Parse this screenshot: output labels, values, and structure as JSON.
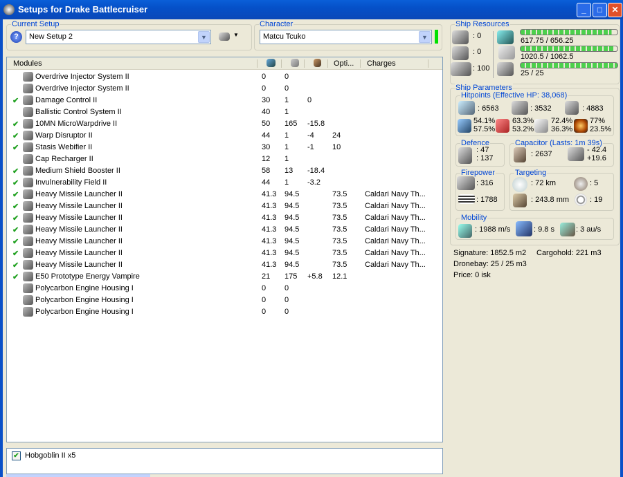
{
  "window": {
    "title": "Setups for Drake Battlecruiser",
    "buttons": {
      "minimize": "_",
      "maximize": "□",
      "close": "✕"
    }
  },
  "setup": {
    "label": "Current Setup",
    "value": "New Setup 2"
  },
  "character": {
    "label": "Character",
    "value": "Matcu Tcuko",
    "status_color": "#00e000"
  },
  "modules": {
    "headers": {
      "name": "Modules",
      "col4": "Opti...",
      "charges": "Charges"
    },
    "rows": [
      {
        "checked": false,
        "name": "Overdrive Injector System II",
        "c1": "0",
        "c2": "0",
        "c3": "",
        "opti": "",
        "charges": ""
      },
      {
        "checked": false,
        "name": "Overdrive Injector System II",
        "c1": "0",
        "c2": "0",
        "c3": "",
        "opti": "",
        "charges": ""
      },
      {
        "checked": true,
        "name": "Damage Control II",
        "c1": "30",
        "c2": "1",
        "c3": "0",
        "opti": "",
        "charges": ""
      },
      {
        "checked": false,
        "name": "Ballistic Control System II",
        "c1": "40",
        "c2": "1",
        "c3": "",
        "opti": "",
        "charges": ""
      },
      {
        "checked": true,
        "name": "10MN MicroWarpdrive II",
        "c1": "50",
        "c2": "165",
        "c3": "-15.8",
        "opti": "",
        "charges": ""
      },
      {
        "checked": true,
        "name": "Warp Disruptor II",
        "c1": "44",
        "c2": "1",
        "c3": "-4",
        "opti": "24",
        "charges": ""
      },
      {
        "checked": true,
        "name": "Stasis Webifier II",
        "c1": "30",
        "c2": "1",
        "c3": "-1",
        "opti": "10",
        "charges": ""
      },
      {
        "checked": false,
        "name": "Cap Recharger II",
        "c1": "12",
        "c2": "1",
        "c3": "",
        "opti": "",
        "charges": ""
      },
      {
        "checked": true,
        "name": "Medium Shield Booster II",
        "c1": "58",
        "c2": "13",
        "c3": "-18.4",
        "opti": "",
        "charges": ""
      },
      {
        "checked": true,
        "name": "Invulnerability Field II",
        "c1": "44",
        "c2": "1",
        "c3": "-3.2",
        "opti": "",
        "charges": ""
      },
      {
        "checked": true,
        "name": "Heavy Missile Launcher II",
        "c1": "41.3",
        "c2": "94.5",
        "c3": "",
        "opti": "73.5",
        "charges": "Caldari Navy Th..."
      },
      {
        "checked": true,
        "name": "Heavy Missile Launcher II",
        "c1": "41.3",
        "c2": "94.5",
        "c3": "",
        "opti": "73.5",
        "charges": "Caldari Navy Th..."
      },
      {
        "checked": true,
        "name": "Heavy Missile Launcher II",
        "c1": "41.3",
        "c2": "94.5",
        "c3": "",
        "opti": "73.5",
        "charges": "Caldari Navy Th..."
      },
      {
        "checked": true,
        "name": "Heavy Missile Launcher II",
        "c1": "41.3",
        "c2": "94.5",
        "c3": "",
        "opti": "73.5",
        "charges": "Caldari Navy Th..."
      },
      {
        "checked": true,
        "name": "Heavy Missile Launcher II",
        "c1": "41.3",
        "c2": "94.5",
        "c3": "",
        "opti": "73.5",
        "charges": "Caldari Navy Th..."
      },
      {
        "checked": true,
        "name": "Heavy Missile Launcher II",
        "c1": "41.3",
        "c2": "94.5",
        "c3": "",
        "opti": "73.5",
        "charges": "Caldari Navy Th..."
      },
      {
        "checked": true,
        "name": "Heavy Missile Launcher II",
        "c1": "41.3",
        "c2": "94.5",
        "c3": "",
        "opti": "73.5",
        "charges": "Caldari Navy Th..."
      },
      {
        "checked": true,
        "name": "E50 Prototype Energy Vampire",
        "c1": "21",
        "c2": "175",
        "c3": "+5.8",
        "opti": "12.1",
        "charges": ""
      },
      {
        "checked": false,
        "name": "Polycarbon Engine Housing I",
        "c1": "0",
        "c2": "0",
        "c3": "",
        "opti": "",
        "charges": ""
      },
      {
        "checked": false,
        "name": "Polycarbon Engine Housing I",
        "c1": "0",
        "c2": "0",
        "c3": "",
        "opti": "",
        "charges": ""
      },
      {
        "checked": false,
        "name": "Polycarbon Engine Housing I",
        "c1": "0",
        "c2": "0",
        "c3": "",
        "opti": "",
        "charges": ""
      }
    ]
  },
  "drones": {
    "checked": true,
    "label": "Hobgoblin II x5"
  },
  "resources": {
    "label": "Ship Resources",
    "turrets": ": 0",
    "launchers": ": 0",
    "calibration": ": 100",
    "cpu": {
      "text": "617.75 / 656.25",
      "fraction": 0.941
    },
    "power": {
      "text": "1020.5 / 1062.5",
      "fraction": 0.96
    },
    "drone_bw": {
      "text": "25 / 25",
      "fraction": 1.0
    }
  },
  "params": {
    "label": "Ship Parameters",
    "hitpoints": {
      "label": "Hitpoints (Effective HP: 38,068)",
      "shield": ": 6563",
      "armor": ": 3532",
      "structure": ": 4883",
      "em": [
        "54.1%",
        "57.5%"
      ],
      "thermal": [
        "63.3%",
        "53.2%"
      ],
      "kinetic": [
        "72.4%",
        "36.3%"
      ],
      "explosive": [
        "77%",
        "23.5%"
      ]
    },
    "defence": {
      "label": "Defence",
      "a": ": 47",
      "b": ": 137"
    },
    "capacitor": {
      "label": "Capacitor (Lasts: 1m 39s)",
      "capacity": ": 2637",
      "use": "- 42.4",
      "recharge": "+19.6"
    },
    "firepower": {
      "label": "Firepower",
      "turret": ": 316",
      "missile": ": 1788"
    },
    "targeting": {
      "label": "Targeting",
      "range": ": 72 km",
      "targets": ": 5",
      "resolution": ": 243.8 mm",
      "sensor": ": 19"
    },
    "mobility": {
      "label": "Mobility",
      "speed": ": 1988 m/s",
      "align": ": 9.8 s",
      "warp": ": 3 au/s"
    },
    "signature": "Signature: 1852.5 m2",
    "cargohold": "Cargohold: 221 m3",
    "dronebay": "Dronebay: 25 / 25 m3",
    "price": "Price: 0 isk"
  }
}
